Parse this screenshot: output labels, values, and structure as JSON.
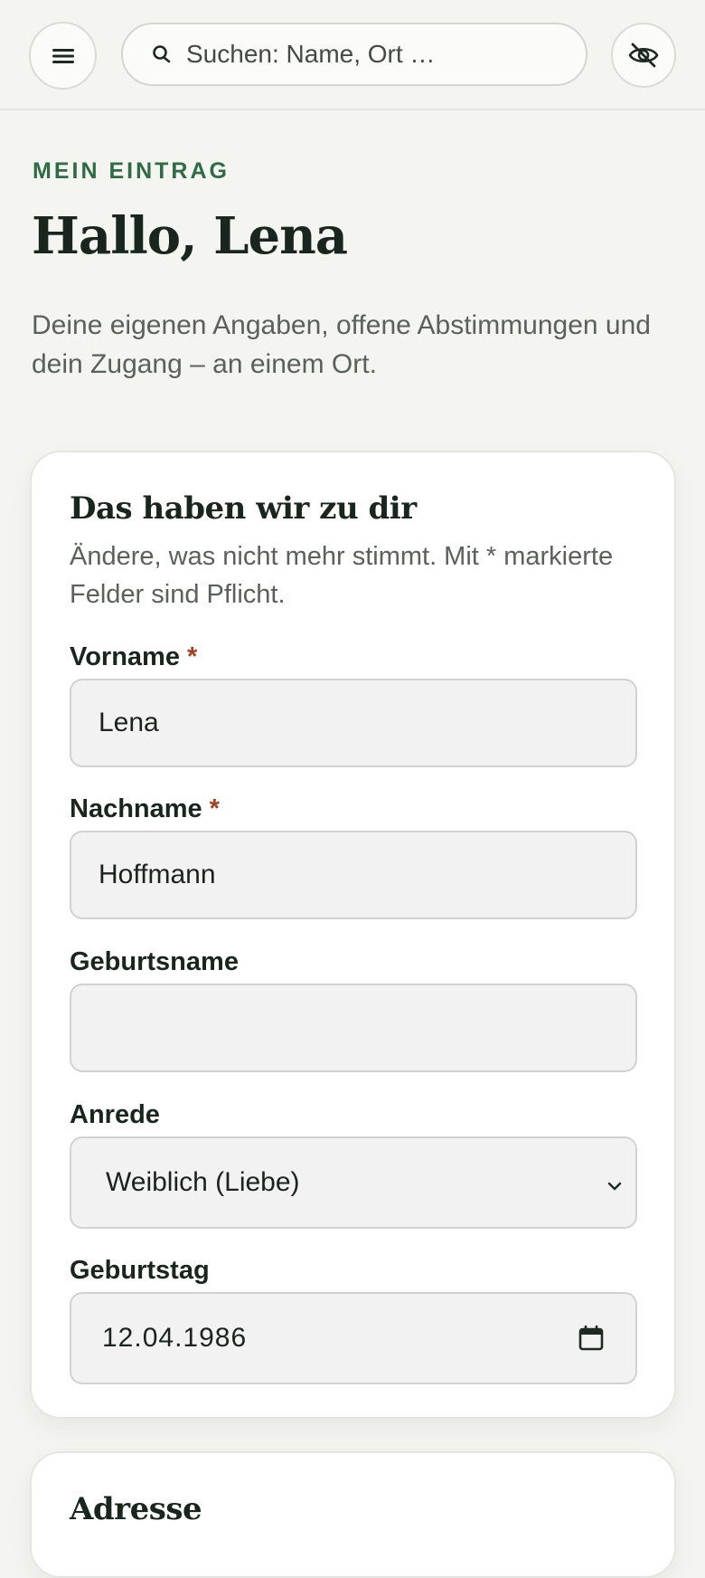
{
  "header": {
    "menu_icon": "hamburger-icon",
    "search": {
      "placeholder": "Suchen: Name, Ort …",
      "icon": "search-icon"
    },
    "privacy_icon": "eye-off-icon"
  },
  "page": {
    "eyebrow": "MEIN EINTRAG",
    "title": "Hallo, Lena",
    "lead": "Deine eigenen Angaben, offene Abstimmungen und dein Zugang – an einem Ort."
  },
  "profile_card": {
    "title": "Das haben wir zu dir",
    "subtitle": "Ändere, was nicht mehr stimmt. Mit * markierte Felder sind Pflicht.",
    "required_marker": "*",
    "fields": {
      "vorname": {
        "label": "Vorname",
        "value": "Lena"
      },
      "nachname": {
        "label": "Nachname",
        "value": "Hoffmann"
      },
      "geburtsname": {
        "label": "Geburtsname",
        "value": ""
      },
      "anrede": {
        "label": "Anrede",
        "value": "Weiblich (Liebe)"
      },
      "geburtstag": {
        "label": "Geburtstag",
        "value": "12.04.1986"
      }
    }
  },
  "address_card": {
    "title": "Adresse"
  },
  "colors": {
    "accent": "#2f6b44",
    "required": "#a3401f",
    "background": "#f4f4f1",
    "card": "#ffffff"
  }
}
